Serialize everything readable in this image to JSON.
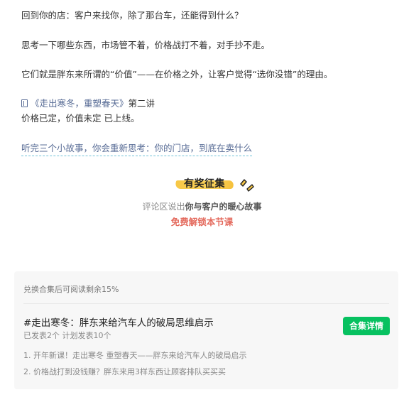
{
  "article": {
    "p1": "回到你的店：客户来找你，除了那台车，还能得到什么？",
    "p2": "思考一下哪些东西，市场管不着，价格战打不着，对手抄不走。",
    "p3": "它们就是胖东来所谓的“价值”——在价格之外，让客户觉得“选你没错”的理由。",
    "series_link": "《走出寒冬，重塑春天》",
    "series_suffix": "第二讲",
    "p5": "价格已定，价值未定 已上线。",
    "teaser": "听完三个小故事，你会重新思考：你的门店，到底在卖什么"
  },
  "prize": {
    "badge": "有奖征集",
    "prompt_prefix": "评论区说出",
    "prompt_bold": "你与客户的暖心故事",
    "free": "免费解锁本节课"
  },
  "collection": {
    "hint": "兑换合集后可阅读剩余15%",
    "title": "#走出寒冬：胖东来给汽车人的破局思维启示",
    "meta": "已发表2个 计划发表10个",
    "detail_button": "合集详情",
    "episodes": [
      "1. 开年新课！走出寒冬 重塑春天——胖东来给汽车人的破局启示",
      "2. 价格战打到没钱赚？胖东来用3样东西让顾客排队买买买"
    ]
  },
  "colors": {
    "link": "#576b95",
    "accent_green": "#07c160",
    "free_red": "#e46a5d",
    "badge_yellow": "#f7c745"
  },
  "icons": [
    "book-icon",
    "sparkle-icon"
  ]
}
